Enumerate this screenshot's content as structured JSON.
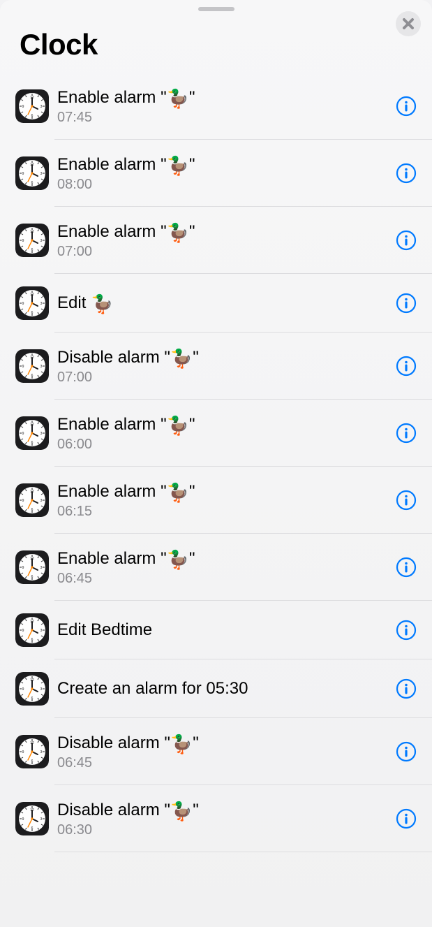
{
  "header": {
    "title": "Clock"
  },
  "emoji": "🦆",
  "items": [
    {
      "prefix": "Enable alarm \"",
      "suffix": "\"",
      "sub": "07:45",
      "has_emoji": true
    },
    {
      "prefix": "Enable alarm \"",
      "suffix": "\"",
      "sub": "08:00",
      "has_emoji": true
    },
    {
      "prefix": "Enable alarm \"",
      "suffix": "\"",
      "sub": "07:00",
      "has_emoji": true
    },
    {
      "prefix": "Edit ",
      "suffix": "",
      "sub": null,
      "has_emoji": true
    },
    {
      "prefix": "Disable alarm \"",
      "suffix": "\"",
      "sub": "07:00",
      "has_emoji": true
    },
    {
      "prefix": "Enable alarm \"",
      "suffix": "\"",
      "sub": "06:00",
      "has_emoji": true
    },
    {
      "prefix": "Enable alarm \"",
      "suffix": "\"",
      "sub": "06:15",
      "has_emoji": true
    },
    {
      "prefix": "Enable alarm \"",
      "suffix": "\"",
      "sub": "06:45",
      "has_emoji": true
    },
    {
      "prefix": "Edit Bedtime",
      "suffix": "",
      "sub": null,
      "has_emoji": false
    },
    {
      "prefix": "Create an alarm for 05:30",
      "suffix": "",
      "sub": null,
      "has_emoji": false
    },
    {
      "prefix": "Disable alarm \"",
      "suffix": "\"",
      "sub": "06:45",
      "has_emoji": true
    },
    {
      "prefix": "Disable alarm \"",
      "suffix": "\"",
      "sub": "06:30",
      "has_emoji": true
    }
  ]
}
